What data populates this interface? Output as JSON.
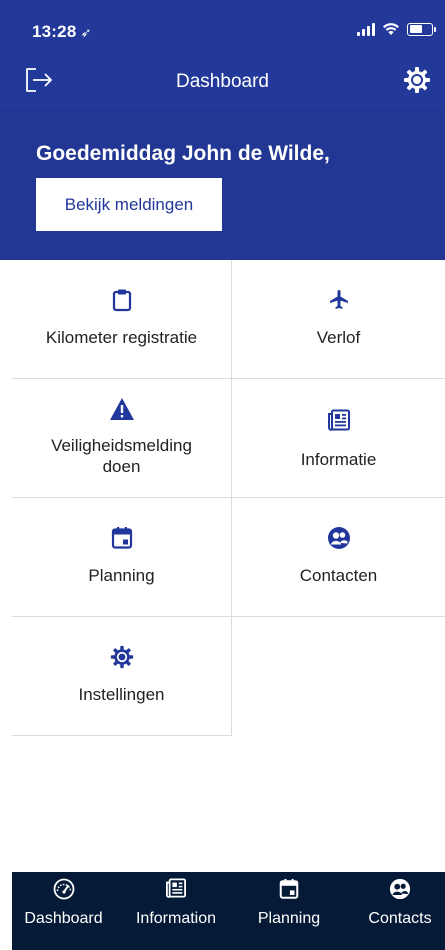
{
  "status": {
    "time": "13:28",
    "location_glyph": "➶"
  },
  "nav": {
    "title": "Dashboard",
    "left_icon": "logout-icon",
    "right_icon": "gear-icon"
  },
  "greeting": {
    "text": "Goedemiddag John de Wilde,",
    "button_label": "Bekijk meldingen"
  },
  "tiles": [
    {
      "id": "kilometer",
      "label": "Kilometer registratie",
      "icon": "clipboard-icon"
    },
    {
      "id": "verlof",
      "label": "Verlof",
      "icon": "airplane-icon"
    },
    {
      "id": "veiligheid",
      "label": "Veiligheidsmelding doen",
      "label_line1": "Veiligheidsmelding",
      "label_line2": "doen",
      "icon": "warning-icon"
    },
    {
      "id": "informatie",
      "label": "Informatie",
      "icon": "newspaper-icon"
    },
    {
      "id": "planning",
      "label": "Planning",
      "icon": "calendar-icon"
    },
    {
      "id": "contacten",
      "label": "Contacten",
      "icon": "contacts-icon"
    },
    {
      "id": "instellingen",
      "label": "Instellingen",
      "icon": "gear-icon"
    }
  ],
  "tabbar": {
    "items": [
      {
        "label": "Dashboard",
        "icon": "speedometer-icon"
      },
      {
        "label": "Information",
        "icon": "newspaper-icon"
      },
      {
        "label": "Planning",
        "icon": "calendar-icon"
      },
      {
        "label": "Contacts",
        "icon": "contacts-icon"
      }
    ]
  },
  "colors": {
    "header": "#23399a",
    "icon": "#22379b",
    "tabbar": "#051a36"
  }
}
